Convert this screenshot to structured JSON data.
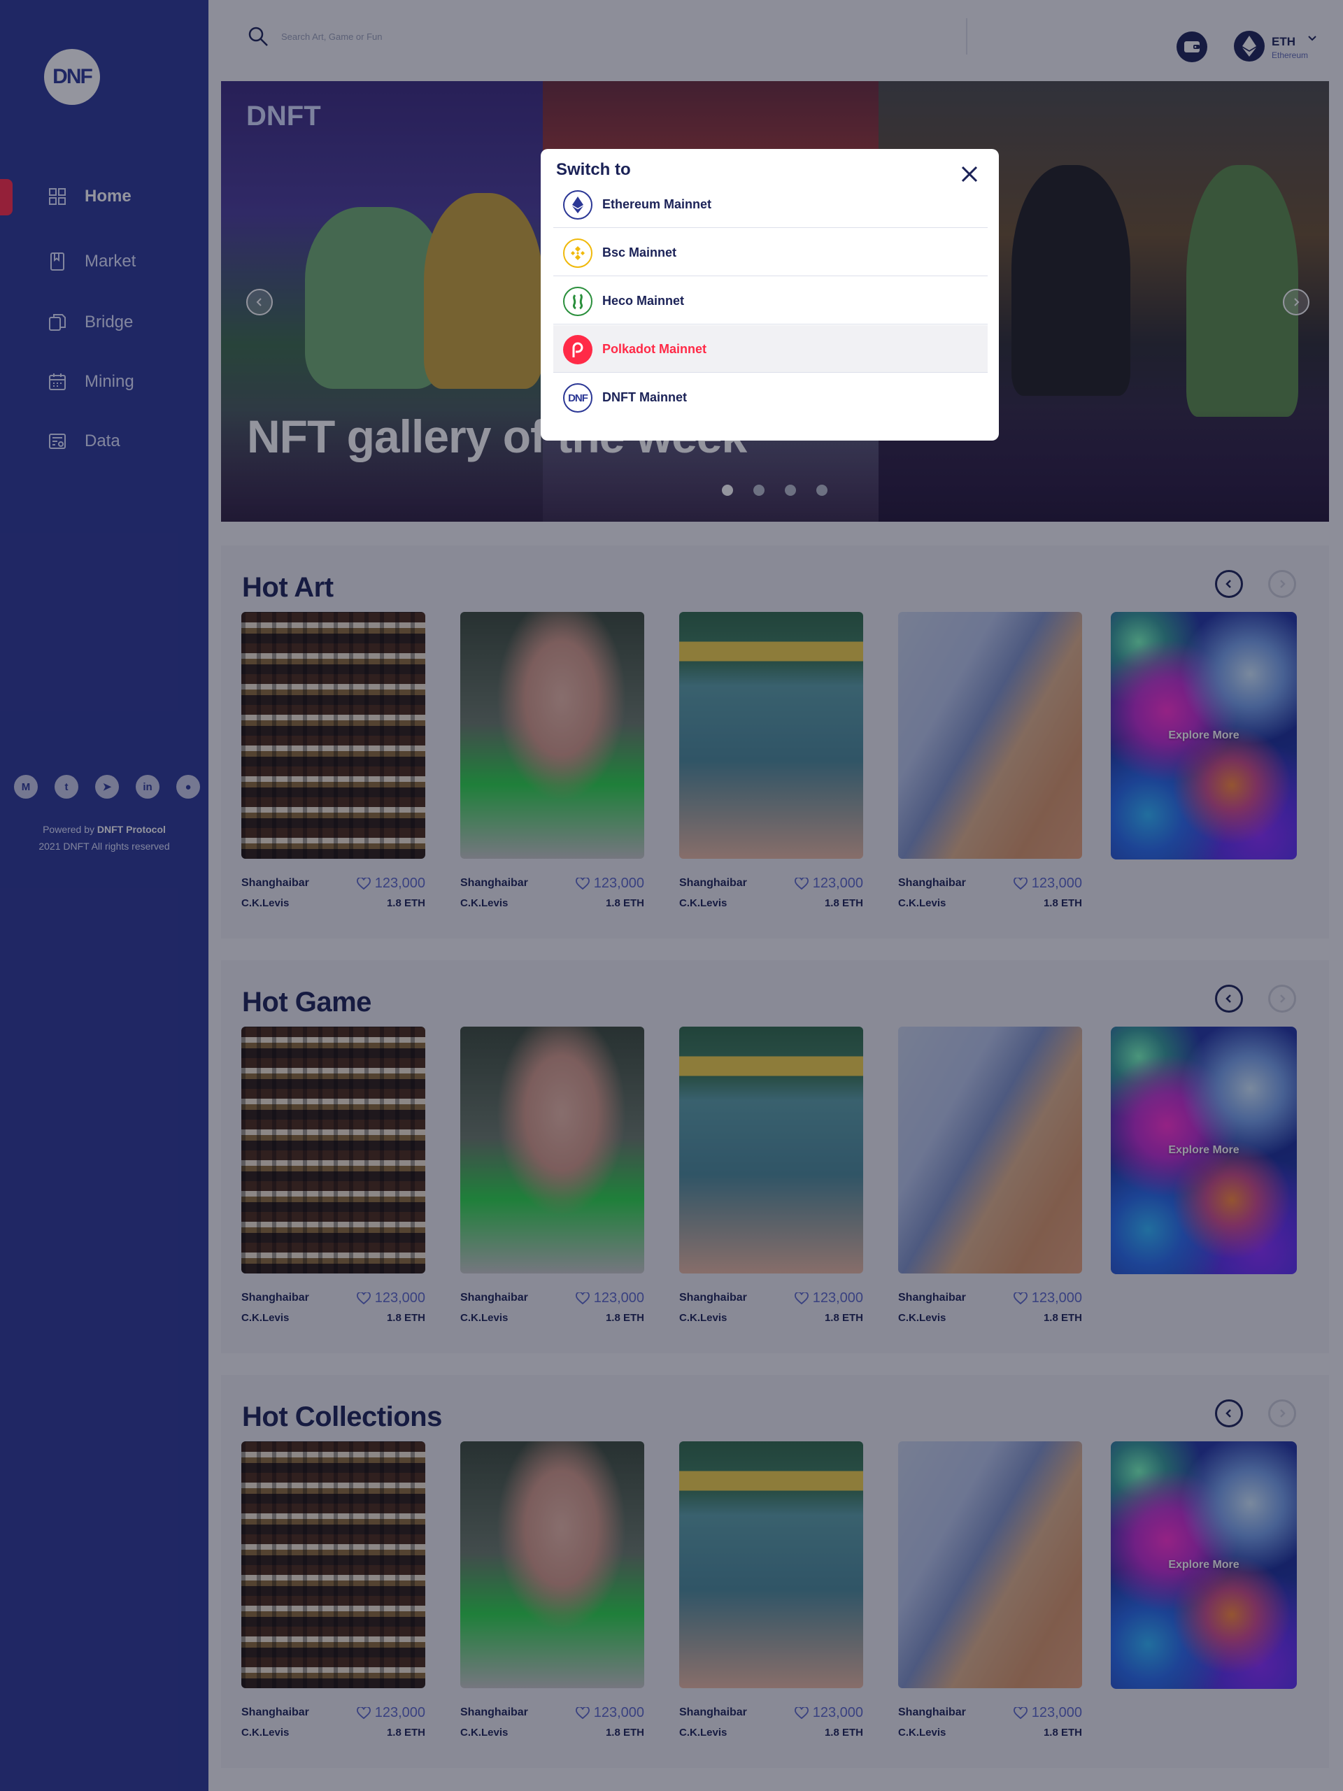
{
  "brand": {
    "logo_text": "DNF"
  },
  "sidebar": {
    "items": [
      {
        "label": "Home",
        "icon": "grid-icon",
        "active": true
      },
      {
        "label": "Market",
        "icon": "bookmark-icon"
      },
      {
        "label": "Bridge",
        "icon": "copy-icon"
      },
      {
        "label": "Mining",
        "icon": "calendar-icon"
      },
      {
        "label": "Data",
        "icon": "chart-icon"
      }
    ],
    "socials": [
      {
        "name": "medium-icon",
        "glyph": "M"
      },
      {
        "name": "twitter-icon",
        "glyph": "t"
      },
      {
        "name": "telegram-icon",
        "glyph": "➤"
      },
      {
        "name": "linkedin-icon",
        "glyph": "in"
      },
      {
        "name": "github-icon",
        "glyph": "●"
      }
    ],
    "footer": {
      "powered_prefix": "Powered by ",
      "powered_brand": "DNFT Protocol",
      "rights": "2021 DNFT All rights reserved"
    }
  },
  "header": {
    "search_placeholder": "Search Art, Game or Fun",
    "network_symbol": "ETH",
    "network_name": "Ethereum"
  },
  "banner": {
    "brand": "DNFT",
    "title": "NFT gallery of the week",
    "slides": 4,
    "active_slide": 0
  },
  "sections": [
    {
      "title": "Hot Art"
    },
    {
      "title": "Hot Game"
    },
    {
      "title": "Hot Collections"
    }
  ],
  "card": {
    "title": "Shanghaibar",
    "likes": "123,000",
    "author": "C.K.Levis",
    "price": "1.8 ETH"
  },
  "explore_label": "Explore More",
  "modal": {
    "title": "Switch to",
    "options": [
      {
        "label": "Ethereum Mainnet",
        "icon": "ethereum-icon",
        "color": "#2b3795"
      },
      {
        "label": "Bsc Mainnet",
        "icon": "binance-icon",
        "color": "#f0b90b"
      },
      {
        "label": "Heco Mainnet",
        "icon": "heco-icon",
        "color": "#2a8f3c"
      },
      {
        "label": "Polkadot Mainnet",
        "icon": "polkadot-icon",
        "color": "#ff2a47",
        "highlighted": true
      },
      {
        "label": "DNFT Mainnet",
        "icon": "dnft-icon",
        "color": "#2b3795"
      }
    ]
  },
  "colors": {
    "sidebar": "#2b3795",
    "accent": "#ff2a47",
    "navy": "#1b2257"
  }
}
